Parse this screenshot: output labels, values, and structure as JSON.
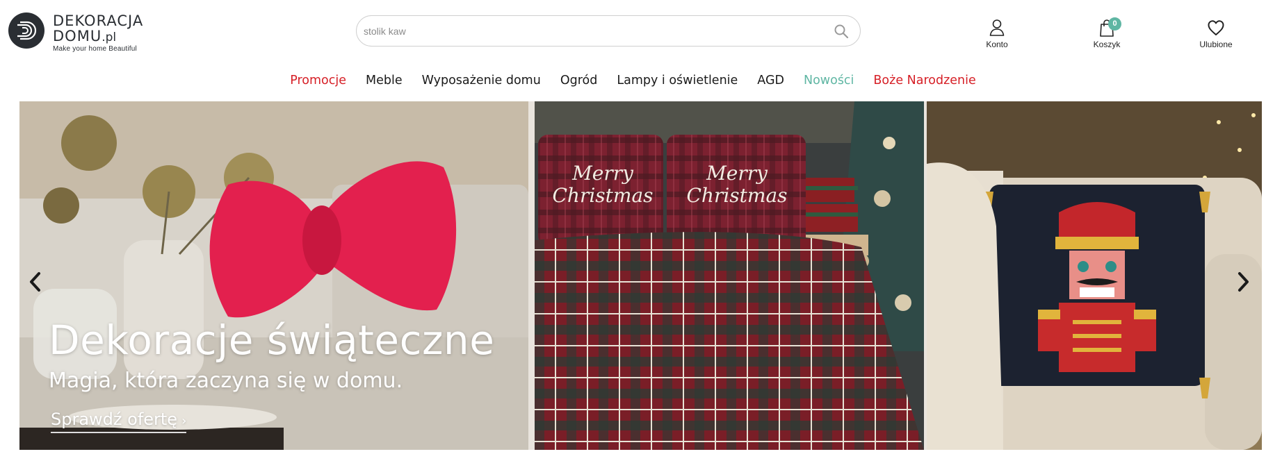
{
  "brand": {
    "line1": "DEKORACJA",
    "line2_main": "DOMU",
    "line2_tld": ".pl",
    "tagline": "Make your home Beautiful",
    "logo_icon": "logo-d-icon"
  },
  "search": {
    "placeholder": "stolik kaw",
    "value": "",
    "icon": "search-icon"
  },
  "header_actions": {
    "account_label": "Konto",
    "cart_label": "Koszyk",
    "cart_count": "0",
    "favorites_label": "Ulubione"
  },
  "nav": {
    "items": [
      {
        "label": "Promocje",
        "color": "#d61f26"
      },
      {
        "label": "Meble",
        "color": "#1a1a1a"
      },
      {
        "label": "Wyposażenie domu",
        "color": "#1a1a1a"
      },
      {
        "label": "Ogród",
        "color": "#1a1a1a"
      },
      {
        "label": "Lampy i oświetlenie",
        "color": "#1a1a1a"
      },
      {
        "label": "AGD",
        "color": "#1a1a1a"
      },
      {
        "label": "Nowości",
        "color": "#5fb6a3"
      },
      {
        "label": "Boże Narodzenie",
        "color": "#d61f26"
      }
    ]
  },
  "hero": {
    "title": "Dekoracje świąteczne",
    "subtitle": "Magia, która zaczyna się w domu.",
    "cta_label": "Sprawdź ofertę",
    "cta_chevron": "›",
    "pillow_text_1": "Merry Christmas",
    "pillow_text_2": "Merry Christmas",
    "prev_icon": "chevron-left-icon",
    "next_icon": "chevron-right-icon"
  },
  "colors": {
    "accent_red": "#d61f26",
    "accent_green": "#5fb6a3",
    "logo_dark": "#2a2e33"
  }
}
